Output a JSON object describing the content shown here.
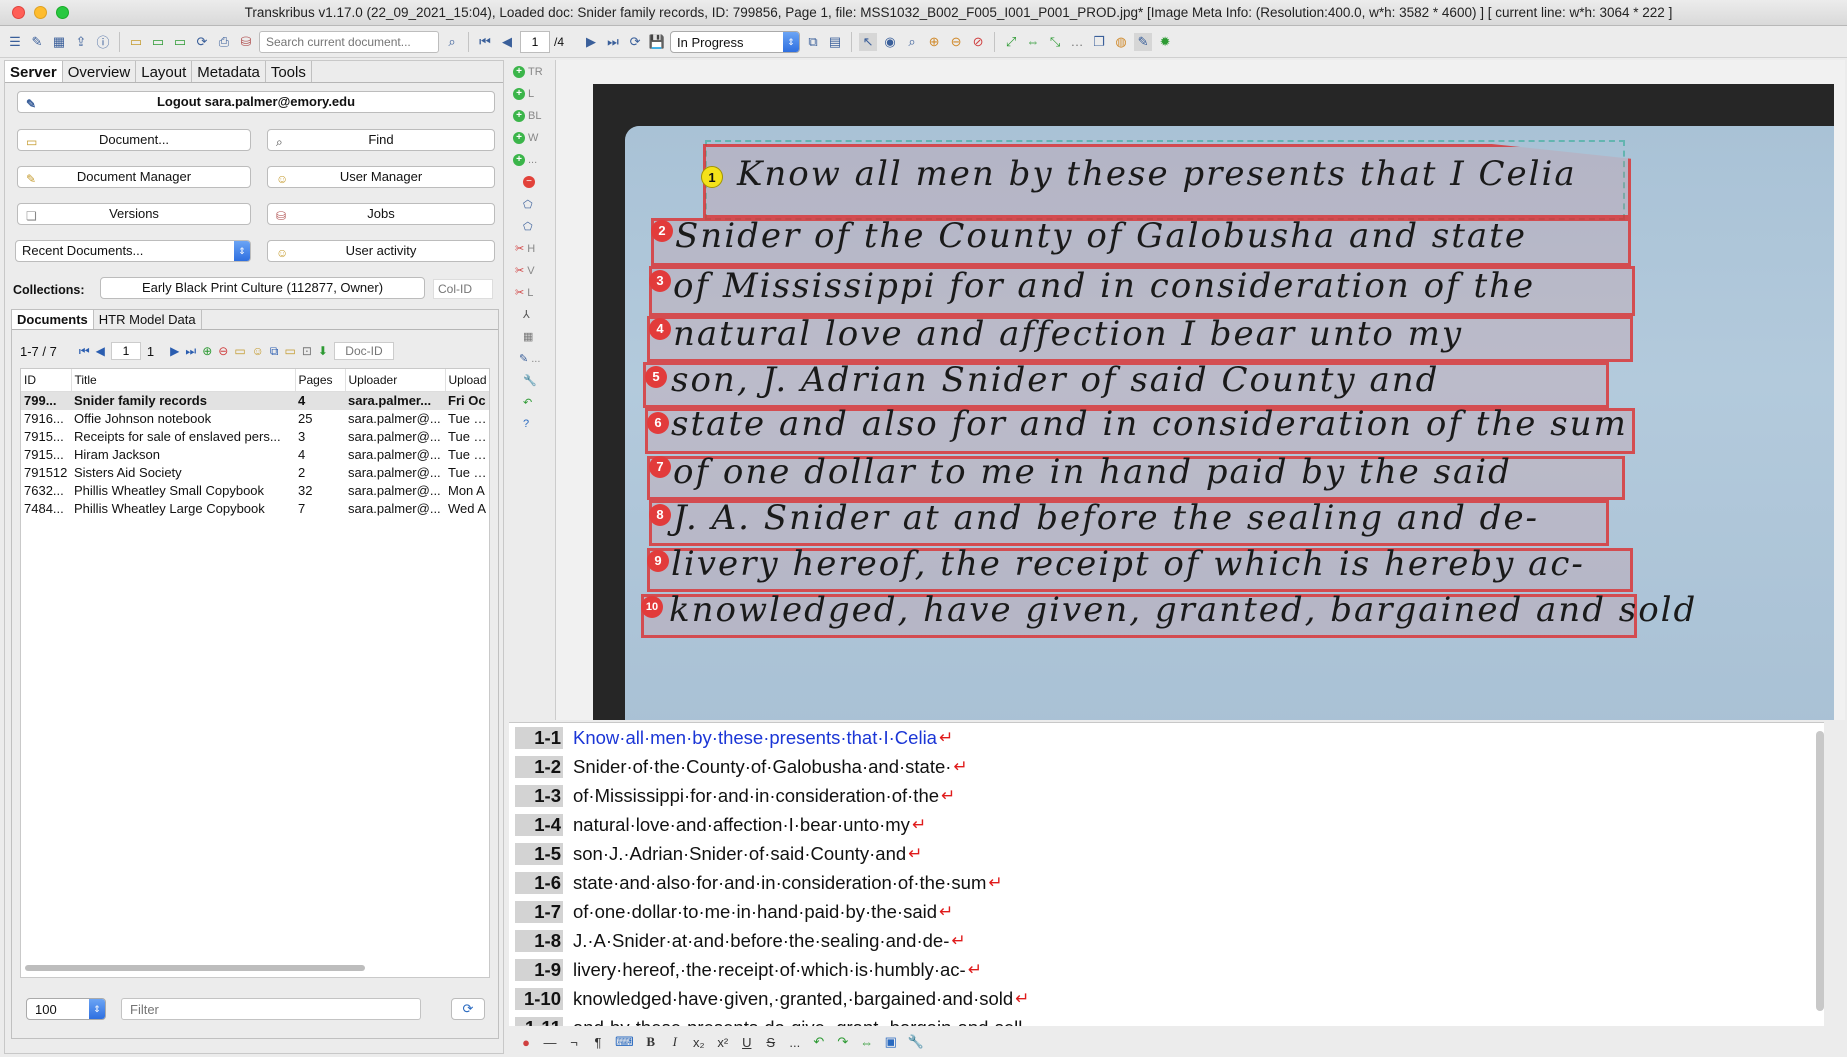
{
  "window": {
    "title": "Transkribus v1.17.0 (22_09_2021_15:04), Loaded doc: Snider family records, ID: 799856, Page 1, file: MSS1032_B002_F005_I001_P001_PROD.jpg* [Image Meta Info: (Resolution:400.0, w*h: 3582 * 4600) ] [ current line: w*h: 3064 * 222 ]"
  },
  "toolbar": {
    "search_placeholder": "Search current document...",
    "page_current": "1",
    "page_total": "/4",
    "status": "In Progress"
  },
  "left_tabs": [
    "Server",
    "Overview",
    "Layout",
    "Metadata",
    "Tools"
  ],
  "server": {
    "logout_label": "Logout sara.palmer@emory.edu",
    "document_btn": "Document...",
    "find_btn": "Find",
    "doc_manager_btn": "Document Manager",
    "user_manager_btn": "User Manager",
    "versions_btn": "Versions",
    "jobs_btn": "Jobs",
    "recent_docs": "Recent Documents...",
    "user_activity_btn": "User activity",
    "collections_label": "Collections:",
    "collection_value": "Early Black Print Culture (112877, Owner)",
    "colid_placeholder": "Col-ID"
  },
  "docs": {
    "subtabs": [
      "Documents",
      "HTR Model Data"
    ],
    "range": "1-7 / 7",
    "page_input": "1",
    "page_count": "1",
    "docid_placeholder": "Doc-ID",
    "columns": [
      "ID",
      "Title",
      "Pages",
      "Uploader",
      "Upload"
    ],
    "rows": [
      {
        "id": "799...",
        "title": "Snider family records",
        "pages": "4",
        "uploader": "sara.palmer...",
        "upload": "Fri Oc"
      },
      {
        "id": "7916...",
        "title": "Offie Johnson notebook",
        "pages": "25",
        "uploader": "sara.palmer@...",
        "upload": "Tue Se"
      },
      {
        "id": "7915...",
        "title": "Receipts for sale of enslaved pers...",
        "pages": "3",
        "uploader": "sara.palmer@...",
        "upload": "Tue Se"
      },
      {
        "id": "7915...",
        "title": "Hiram Jackson",
        "pages": "4",
        "uploader": "sara.palmer@...",
        "upload": "Tue Se"
      },
      {
        "id": "791512",
        "title": "Sisters Aid Society",
        "pages": "2",
        "uploader": "sara.palmer@...",
        "upload": "Tue Se"
      },
      {
        "id": "7632...",
        "title": "Phillis Wheatley Small Copybook",
        "pages": "32",
        "uploader": "sara.palmer@...",
        "upload": "Mon A"
      },
      {
        "id": "7484...",
        "title": "Phillis Wheatley Large Copybook",
        "pages": "7",
        "uploader": "sara.palmer@...",
        "upload": "Wed A"
      }
    ],
    "page_size": "100",
    "filter_placeholder": "Filter"
  },
  "side_tools": [
    "TR",
    "L",
    "BL",
    "W",
    "...",
    "H",
    "V",
    "L",
    "..."
  ],
  "image": {
    "markers": [
      "1",
      "2",
      "3",
      "4",
      "5",
      "6",
      "7",
      "8",
      "9",
      "10"
    ],
    "handwriting": [
      "Know all men by these presents that I Celia",
      "Snider of the County of Galobusha and state",
      "of Mississippi for and in consideration of the",
      "natural love and affection I bear unto my",
      "son, J. Adrian Snider of said County and",
      "state and also for and in consideration of the sum",
      "of one dollar to me in hand paid by the said",
      "J. A. Snider at and before the sealing and de-",
      "livery hereof, the receipt of which is hereby ac-",
      "knowledged, have given, granted, bargained and sold"
    ]
  },
  "transcript": [
    {
      "num": "1-1",
      "text": "Know·all·men·by·these·presents·that·I·Celia"
    },
    {
      "num": "1-2",
      "text": "Snider·of·the·County·of·Galobusha·and·state·"
    },
    {
      "num": "1-3",
      "text": "of·Mississippi·for·and·in·consideration·of·the"
    },
    {
      "num": "1-4",
      "text": "natural·love·and·affection·I·bear·unto·my"
    },
    {
      "num": "1-5",
      "text": "son·J.·Adrian·Snider·of·said·County·and"
    },
    {
      "num": "1-6",
      "text": "state·and·also·for·and·in·consideration·of·the·sum"
    },
    {
      "num": "1-7",
      "text": "of·one·dollar·to·me·in·hand·paid·by·the·said"
    },
    {
      "num": "1-8",
      "text": "J.·A·Snider·at·and·before·the·sealing·and·de-"
    },
    {
      "num": "1-9",
      "text": "livery·hereof,·the·receipt·of·which·is·humbly·ac-"
    },
    {
      "num": "1-10",
      "text": "knowledged·have·given,·granted,·bargained·and·sold"
    },
    {
      "num": "1-11",
      "text": "and·by·these·presents·do·give,·grant,·bargain·and·sell"
    }
  ],
  "editor_toolbar": [
    "B",
    "I",
    "x₂",
    "x²",
    "U",
    "S",
    "..."
  ]
}
